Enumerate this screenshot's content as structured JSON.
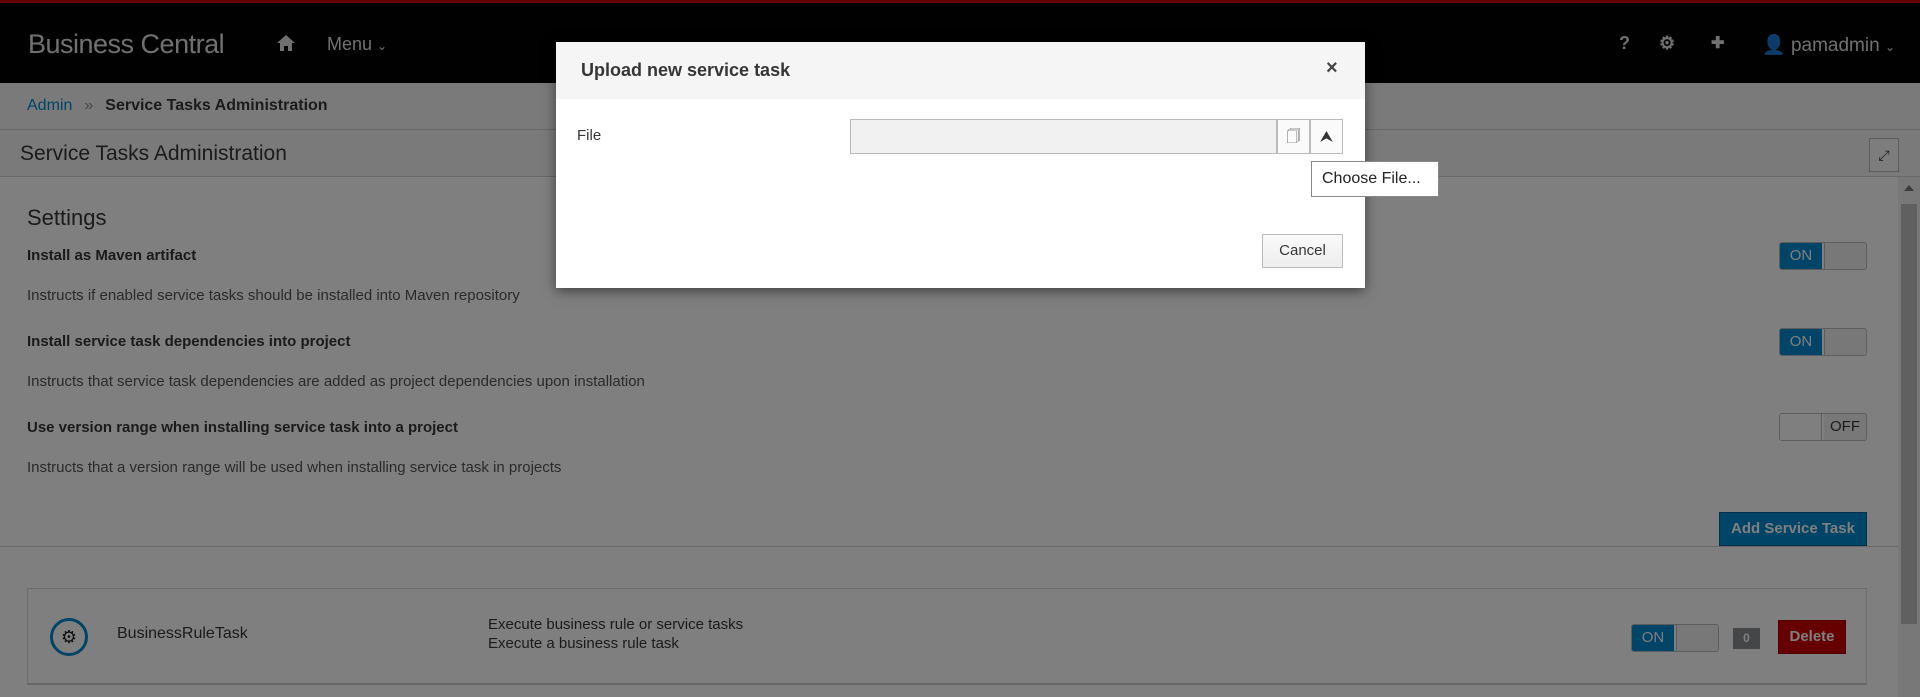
{
  "header": {
    "brand": "Business Central",
    "menu_label": "Menu",
    "user": "pamadmin",
    "icons": [
      "home-icon",
      "help-icon",
      "gear-icon",
      "first-aid-icon",
      "user-icon"
    ]
  },
  "breadcrumb": {
    "items": [
      {
        "label": "Admin"
      },
      {
        "label": "Service Tasks Administration"
      }
    ],
    "separator": "»"
  },
  "page": {
    "title": "Service Tasks Administration"
  },
  "settings": {
    "heading": "Settings",
    "options": [
      {
        "label": "Install as Maven artifact",
        "description": "Instructs if enabled service tasks should be installed into Maven repository",
        "state": "ON"
      },
      {
        "label": "Install service task dependencies into project",
        "description": "Instructs that service task dependencies are added as project dependencies upon installation",
        "state": "ON"
      },
      {
        "label": "Use version range when installing service task into a project",
        "description": "Instructs that a version range will be used when installing service task in projects",
        "state": "OFF"
      }
    ],
    "add_button": "Add Service Task"
  },
  "tasks": [
    {
      "name": "BusinessRuleTask",
      "description_lines": [
        "Execute business rule or service tasks",
        "Execute a business rule task"
      ],
      "state": "ON",
      "count": "0",
      "delete_label": "Delete"
    }
  ],
  "modal": {
    "title": "Upload new service task",
    "close": "×",
    "file_label": "File",
    "file_value": "",
    "tooltip": "Choose File...",
    "cancel_label": "Cancel"
  },
  "colors": {
    "accent": "#0088ce",
    "danger": "#cc0000",
    "header": "#030303"
  }
}
